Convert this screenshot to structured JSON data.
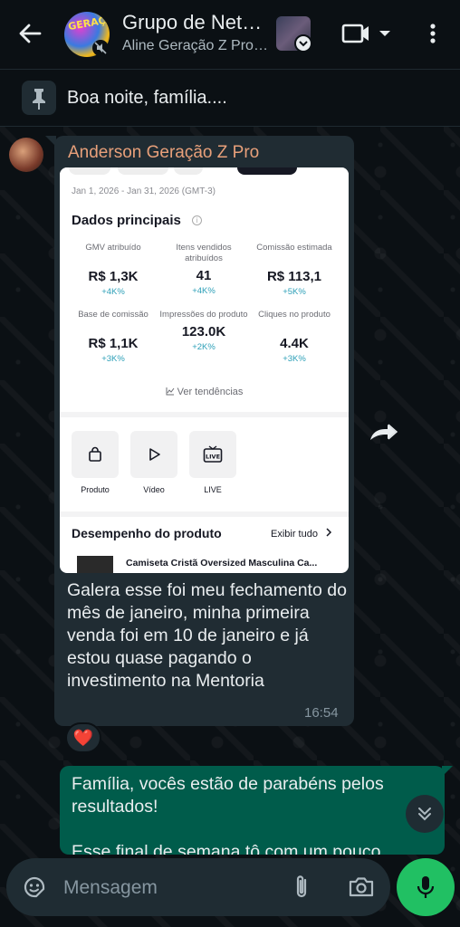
{
  "header": {
    "title": "Grupo de Net…",
    "subtitle": "Aline Geração Z Pro…",
    "avatar_text": "GERAÇÃO"
  },
  "pinned": {
    "text": "Boa noite, família...."
  },
  "incoming": {
    "sender": "Anderson Geração Z Pro",
    "screenshot": {
      "date_range": "Jan 1, 2026 - Jan 31, 2026 (GMT-3)",
      "kpi_title": "Dados principais",
      "kpis": [
        {
          "label": "GMV atribuído",
          "value": "R$ 1,3K",
          "delta": "+4K%"
        },
        {
          "label": "Itens vendidos atribuídos",
          "value": "41",
          "delta": "+4K%"
        },
        {
          "label": "Comissão estimada",
          "value": "R$ 113,1",
          "delta": "+5K%"
        },
        {
          "label": "Base de comissão",
          "value": "R$ 1,1K",
          "delta": "+3K%"
        },
        {
          "label": "Impressões do produto",
          "value": "123.0K",
          "delta": "+2K%"
        },
        {
          "label": "Cliques no produto",
          "value": "4.4K",
          "delta": "+3K%"
        }
      ],
      "trends_link": "Ver tendências",
      "tools": [
        {
          "label": "Produto",
          "icon": "shopping-bag-icon"
        },
        {
          "label": "Vídeo",
          "icon": "play-icon"
        },
        {
          "label": "LIVE",
          "icon": "live-tv-icon"
        }
      ],
      "performance_title": "Desempenho do produto",
      "performance_link": "Exibir tudo",
      "product_name": "Camiseta Cristã Oversized Masculina Ca..."
    },
    "caption": "Galera esse foi meu fechamento do mês de janeiro, minha primeira venda foi em 10 de janeiro e já estou quase pagando o investimento na Mentoria",
    "time": "16:54",
    "reaction": "❤️"
  },
  "outgoing": {
    "text_line1": "Família, vocês estão de parabéns pelos resultados!",
    "text_line2": "Esse final de semana tô com um pouco"
  },
  "composer": {
    "placeholder": "Mensagem"
  },
  "colors": {
    "background": "#0b1014",
    "incoming_bubble": "#202c33",
    "outgoing_bubble": "#005c4b",
    "accent_green": "#21c063",
    "sender_name": "#e8a07a"
  }
}
